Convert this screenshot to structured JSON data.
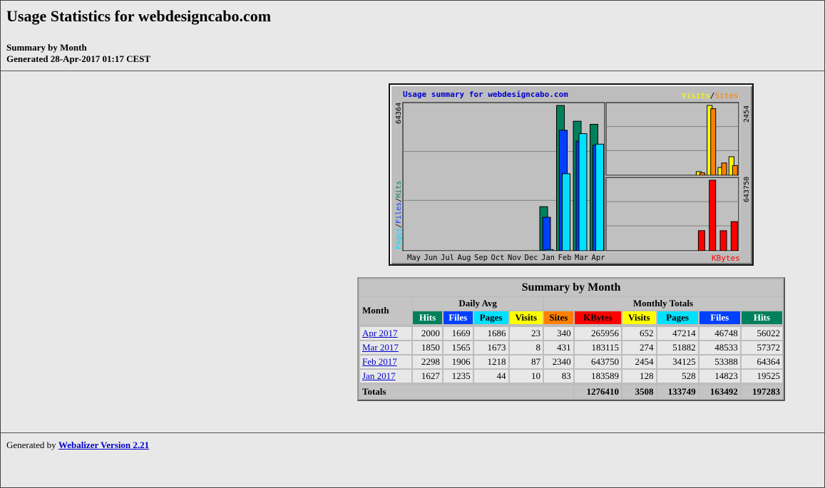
{
  "page": {
    "title": "Usage Statistics for webdesigncabo.com",
    "subtitle": "Summary by Month",
    "generated": "Generated 28-Apr-2017 01:17 CEST"
  },
  "footer": {
    "prefix": "Generated by ",
    "link": "Webalizer Version 2.21"
  },
  "chart_data": {
    "type": "bar",
    "title": "Usage summary for webdesigncabo.com",
    "categories": [
      "May",
      "Jun",
      "Jul",
      "Aug",
      "Sep",
      "Oct",
      "Nov",
      "Dec",
      "Jan",
      "Feb",
      "Mar",
      "Apr"
    ],
    "left_panel": {
      "ymax": 64364,
      "ylabel_parts": [
        "Pages",
        "/",
        "Files",
        "/",
        "Hits"
      ],
      "series": [
        {
          "name": "Hits",
          "color": "#00805c",
          "values": [
            0,
            0,
            0,
            0,
            0,
            0,
            0,
            0,
            19525,
            64364,
            57372,
            56022
          ]
        },
        {
          "name": "Files",
          "color": "#0040ff",
          "values": [
            0,
            0,
            0,
            0,
            0,
            0,
            0,
            0,
            14823,
            53388,
            48533,
            46748
          ]
        },
        {
          "name": "Pages",
          "color": "#00e0ff",
          "values": [
            0,
            0,
            0,
            0,
            0,
            0,
            0,
            0,
            528,
            34125,
            51882,
            47214
          ]
        }
      ]
    },
    "top_right_panel": {
      "ymax": 2454,
      "legend_parts": [
        "Visits",
        "/",
        "Sites"
      ],
      "series": [
        {
          "name": "Visits",
          "color": "#ffff00",
          "values": [
            0,
            0,
            0,
            0,
            0,
            0,
            0,
            0,
            128,
            2454,
            274,
            652
          ]
        },
        {
          "name": "Sites",
          "color": "#ff8000",
          "values": [
            0,
            0,
            0,
            0,
            0,
            0,
            0,
            0,
            83,
            2340,
            431,
            340
          ]
        }
      ]
    },
    "bottom_right_panel": {
      "ymax": 643750,
      "legend": "KBytes",
      "series": [
        {
          "name": "KBytes",
          "color": "#ff0000",
          "values": [
            0,
            0,
            0,
            0,
            0,
            0,
            0,
            0,
            183589,
            643750,
            183115,
            265956
          ]
        }
      ]
    },
    "colors": {
      "title": "#0000cc",
      "axis_text": "#000000",
      "grid": "#808080"
    }
  },
  "table": {
    "title": "Summary by Month",
    "month_header": "Month",
    "daily_avg_header": "Daily Avg",
    "monthly_totals_header": "Monthly Totals",
    "daily_cols": [
      "Hits",
      "Files",
      "Pages",
      "Visits"
    ],
    "monthly_cols": [
      "Sites",
      "KBytes",
      "Visits",
      "Pages",
      "Files",
      "Hits"
    ],
    "rows": [
      {
        "month": "Apr 2017",
        "d_hits": "2000",
        "d_files": "1669",
        "d_pages": "1686",
        "d_visits": "23",
        "sites": "340",
        "kbytes": "265956",
        "visits": "652",
        "pages": "47214",
        "files": "46748",
        "hits": "56022"
      },
      {
        "month": "Mar 2017",
        "d_hits": "1850",
        "d_files": "1565",
        "d_pages": "1673",
        "d_visits": "8",
        "sites": "431",
        "kbytes": "183115",
        "visits": "274",
        "pages": "51882",
        "files": "48533",
        "hits": "57372"
      },
      {
        "month": "Feb 2017",
        "d_hits": "2298",
        "d_files": "1906",
        "d_pages": "1218",
        "d_visits": "87",
        "sites": "2340",
        "kbytes": "643750",
        "visits": "2454",
        "pages": "34125",
        "files": "53388",
        "hits": "64364"
      },
      {
        "month": "Jan 2017",
        "d_hits": "1627",
        "d_files": "1235",
        "d_pages": "44",
        "d_visits": "10",
        "sites": "83",
        "kbytes": "183589",
        "visits": "128",
        "pages": "528",
        "files": "14823",
        "hits": "19525"
      }
    ],
    "totals": {
      "label": "Totals",
      "kbytes": "1276410",
      "visits": "3508",
      "pages": "133749",
      "files": "163492",
      "hits": "197283"
    }
  }
}
